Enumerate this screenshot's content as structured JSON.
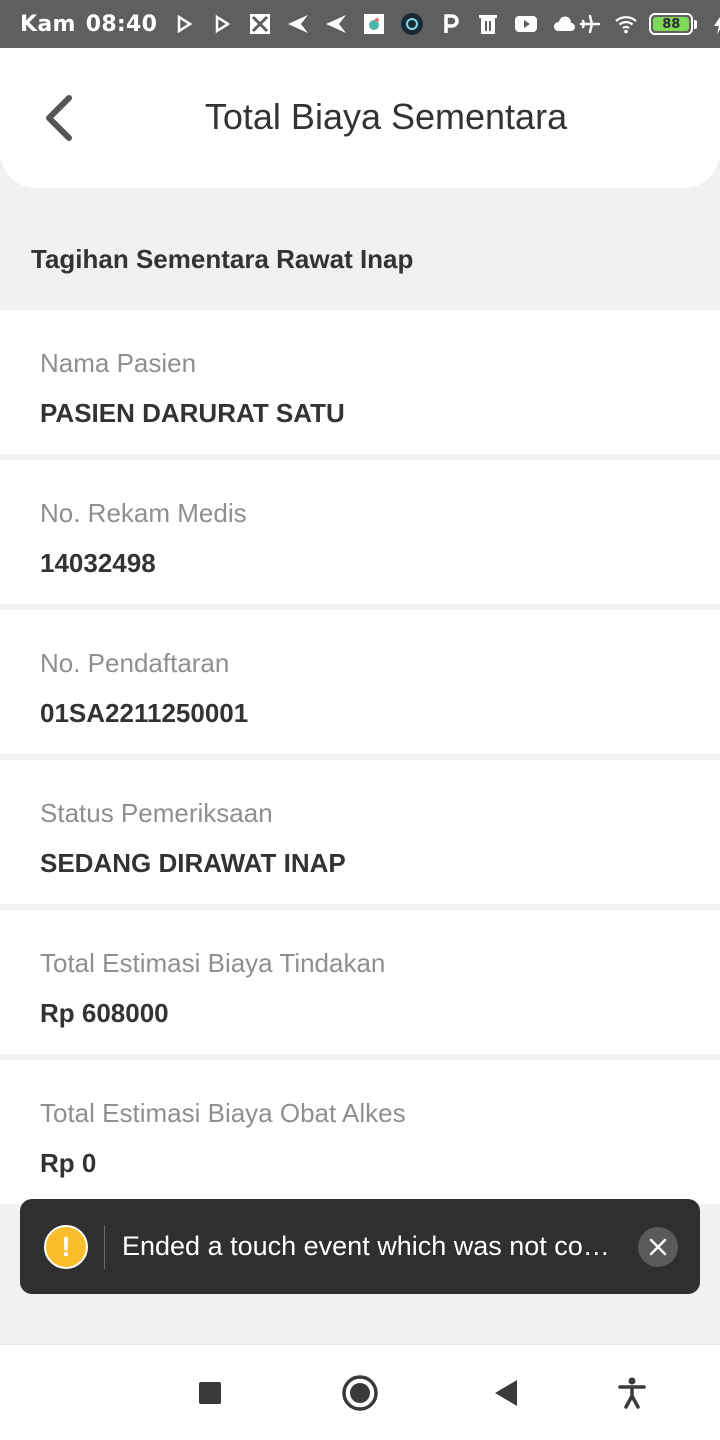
{
  "status_bar": {
    "day": "Kam",
    "time": "08:40",
    "battery": "88"
  },
  "header": {
    "title": "Total Biaya Sementara"
  },
  "section": {
    "title": "Tagihan Sementara Rawat Inap"
  },
  "details": [
    {
      "label": "Nama Pasien",
      "value": "PASIEN DARURAT SATU"
    },
    {
      "label": "No. Rekam Medis",
      "value": "14032498"
    },
    {
      "label": "No. Pendaftaran",
      "value": "01SA2211250001"
    },
    {
      "label": "Status Pemeriksaan",
      "value": "SEDANG DIRAWAT INAP"
    },
    {
      "label": "Total Estimasi Biaya Tindakan",
      "value": "Rp 608000"
    },
    {
      "label": "Total Estimasi Biaya Obat Alkes",
      "value": "Rp 0"
    }
  ],
  "toast": {
    "icon": "warning-icon",
    "message": "Ended a touch event which was not counted in `trackedTouchCount`."
  },
  "nav": {
    "icons": [
      "recents-square-icon",
      "home-circle-icon",
      "back-triangle-icon",
      "accessibility-icon"
    ]
  },
  "colors": {
    "status_bar_bg": "#5f5f5f",
    "page_bg": "#f1f1f1",
    "toast_bg": "#2f2f2f",
    "warning": "#fbbd2c",
    "battery": "#7ed957"
  }
}
